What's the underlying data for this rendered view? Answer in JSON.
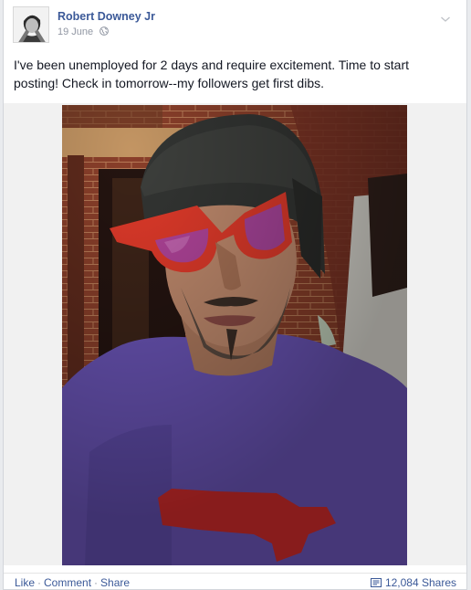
{
  "post": {
    "author": "Robert Downey Jr",
    "date": "19 June",
    "message": "I've been unemployed for 2 days and require excitement. Time to start posting! Check in tomorrow--my followers get first dibs.",
    "avatar_icon": "profile-photo",
    "privacy_icon": "globe-icon",
    "menu_icon": "chevron-down-icon"
  },
  "footer": {
    "actions": [
      "Like",
      "Comment",
      "Share"
    ],
    "separator": "·",
    "shares_label": "12,084 Shares",
    "shares_icon": "share-icon"
  },
  "colors": {
    "link": "#3b5998",
    "meta": "#9197a3",
    "background": "#e9ebee"
  }
}
